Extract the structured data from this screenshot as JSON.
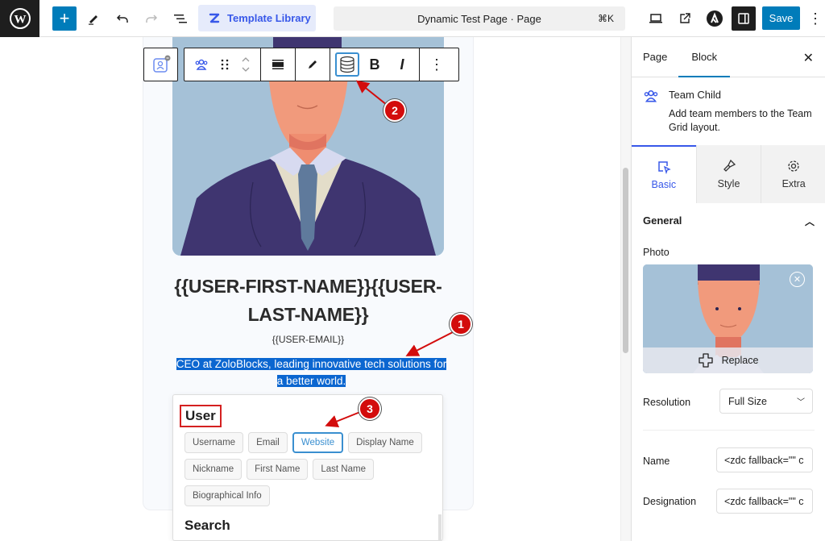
{
  "topbar": {
    "template_library_label": "Template Library",
    "command_title": "Dynamic Test Page · Page",
    "command_shortcut": "⌘K",
    "save_label": "Save"
  },
  "block_toolbar": {
    "tools": [
      "parent-block",
      "team-child",
      "drag",
      "move-up-down",
      "align",
      "edit",
      "dynamic-content",
      "bold",
      "italic",
      "more-options"
    ],
    "bold_label": "B",
    "italic_label": "I",
    "active_tool": "dynamic-content"
  },
  "card": {
    "name": "{{USER-FIRST-NAME}}{{USER-LAST-NAME}}",
    "email": "{{USER-EMAIL}}",
    "bio": "CEO at ZoloBlocks, leading innovative tech solutions for a better world."
  },
  "popover": {
    "section_title": "User",
    "chips": [
      "Username",
      "Email",
      "Website",
      "Display Name",
      "Nickname",
      "First Name",
      "Last Name",
      "Biographical Info"
    ],
    "selected_chip": "Website",
    "next_section_title": "Search"
  },
  "callouts": [
    "1",
    "2",
    "3"
  ],
  "sidebar": {
    "tabs": [
      "Page",
      "Block"
    ],
    "active_tab": "Block",
    "block_title": "Team Child",
    "block_description": "Add team members to the Team Grid layout.",
    "segments": [
      "Basic",
      "Style",
      "Extra"
    ],
    "active_segment": "Basic",
    "section_title": "General",
    "photo_label": "Photo",
    "replace_label": "Replace",
    "resolution_label": "Resolution",
    "resolution_value": "Full Size",
    "name_label": "Name",
    "name_value": "<zdc fallback=\"\" c",
    "designation_label": "Designation",
    "designation_value": "<zdc fallback=\"\" c"
  }
}
